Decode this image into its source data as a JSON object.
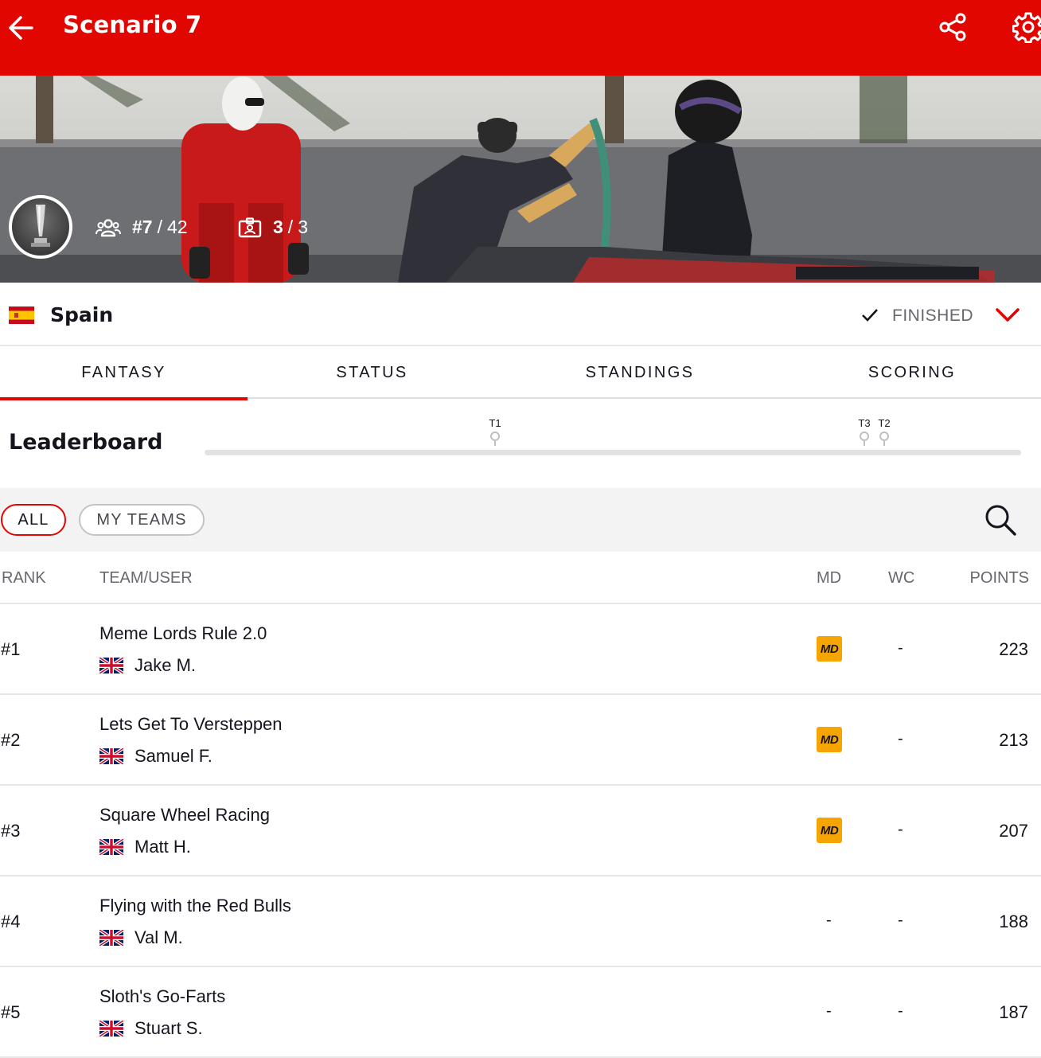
{
  "header": {
    "title": "Scenario 7",
    "back_icon": "arrow-left-icon",
    "share_icon": "share-icon",
    "settings_icon": "gear-icon",
    "bar_color": "#e10600"
  },
  "hero": {
    "rank_label": "#7",
    "rank_total": "42",
    "races_done": "3",
    "races_total": "3",
    "rank_icon": "users-icon",
    "races_icon": "badge-icon"
  },
  "race": {
    "country": "Spain",
    "status": "FINISHED",
    "status_icon": "check-icon",
    "expand_icon": "chevron-down-icon"
  },
  "tabs": [
    {
      "label": "FANTASY",
      "active": true
    },
    {
      "label": "STATUS",
      "active": false
    },
    {
      "label": "STANDINGS",
      "active": false
    },
    {
      "label": "SCORING",
      "active": false
    }
  ],
  "leaderboard": {
    "title": "Leaderboard",
    "markers": [
      "T1",
      "T3",
      "T2"
    ]
  },
  "filters": {
    "all_label": "ALL",
    "my_teams_label": "MY TEAMS",
    "search_icon": "search-icon"
  },
  "table": {
    "columns": {
      "rank": "RANK",
      "team": "TEAM/USER",
      "md": "MD",
      "wc": "WC",
      "points": "POINTS"
    },
    "rows": [
      {
        "rank": "#1",
        "team": "Meme Lords Rule 2.0",
        "user": "Jake M.",
        "md": "MD",
        "wc": "-",
        "points": "223"
      },
      {
        "rank": "#2",
        "team": "Lets Get To Versteppen",
        "user": "Samuel F.",
        "md": "MD",
        "wc": "-",
        "points": "213"
      },
      {
        "rank": "#3",
        "team": "Square Wheel Racing",
        "user": "Matt H.",
        "md": "MD",
        "wc": "-",
        "points": "207"
      },
      {
        "rank": "#4",
        "team": "Flying with the Red Bulls",
        "user": "Val M.",
        "md": "-",
        "wc": "-",
        "points": "188"
      },
      {
        "rank": "#5",
        "team": "Sloth's Go-Farts",
        "user": "Stuart S.",
        "md": "-",
        "wc": "-",
        "points": "187"
      }
    ]
  }
}
